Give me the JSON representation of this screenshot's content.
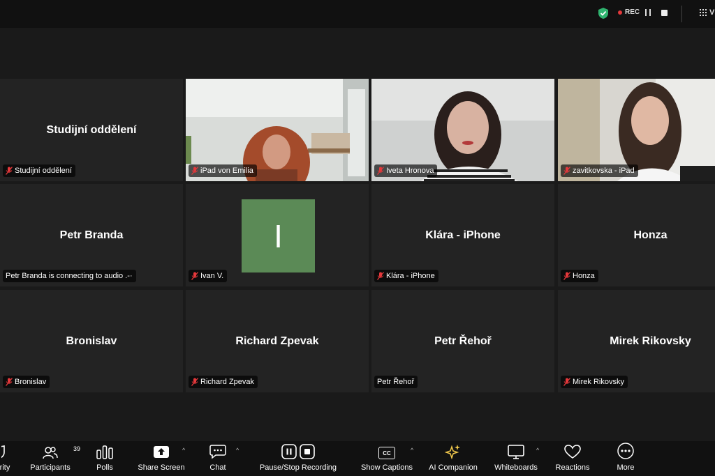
{
  "topbar": {
    "rec_label": "REC",
    "view_label": "V"
  },
  "tiles": [
    {
      "center": "Studijní oddělení",
      "tag": "Studijní oddělení"
    },
    {
      "tag": "iPad von Emilia"
    },
    {
      "tag": "Iveta Hronova"
    },
    {
      "tag": "zavitkovska - iPad"
    },
    {
      "center": "Petr Branda",
      "tag": "Petr Branda is connecting to audio .-·"
    },
    {
      "avatar": "I",
      "tag": "Ivan V."
    },
    {
      "center": "Klára - iPhone",
      "tag": "Klára - iPhone"
    },
    {
      "center": "Honza",
      "tag": "Honza"
    },
    {
      "center": "Bronislav",
      "tag": "Bronislav"
    },
    {
      "center": "Richard Zpevak",
      "tag": "Richard Zpevak"
    },
    {
      "center": "Petr Řehoř",
      "tag": "Petr Řehoř"
    },
    {
      "center": "Mirek Rikovsky",
      "tag": "Mirek Rikovsky"
    }
  ],
  "toolbar": {
    "security": "rity",
    "participants": "Participants",
    "participants_count": "39",
    "polls": "Polls",
    "share": "Share Screen",
    "chat": "Chat",
    "recording": "Pause/Stop Recording",
    "captions": "Show Captions",
    "cc_icon_text": "CC",
    "ai": "AI Companion",
    "whiteboards": "Whiteboards",
    "reactions": "Reactions",
    "more": "More"
  },
  "colors": {
    "avatar_bg": "#5b8a56",
    "mic_muted": "#e5383b",
    "rec_dot": "#e5383b"
  }
}
